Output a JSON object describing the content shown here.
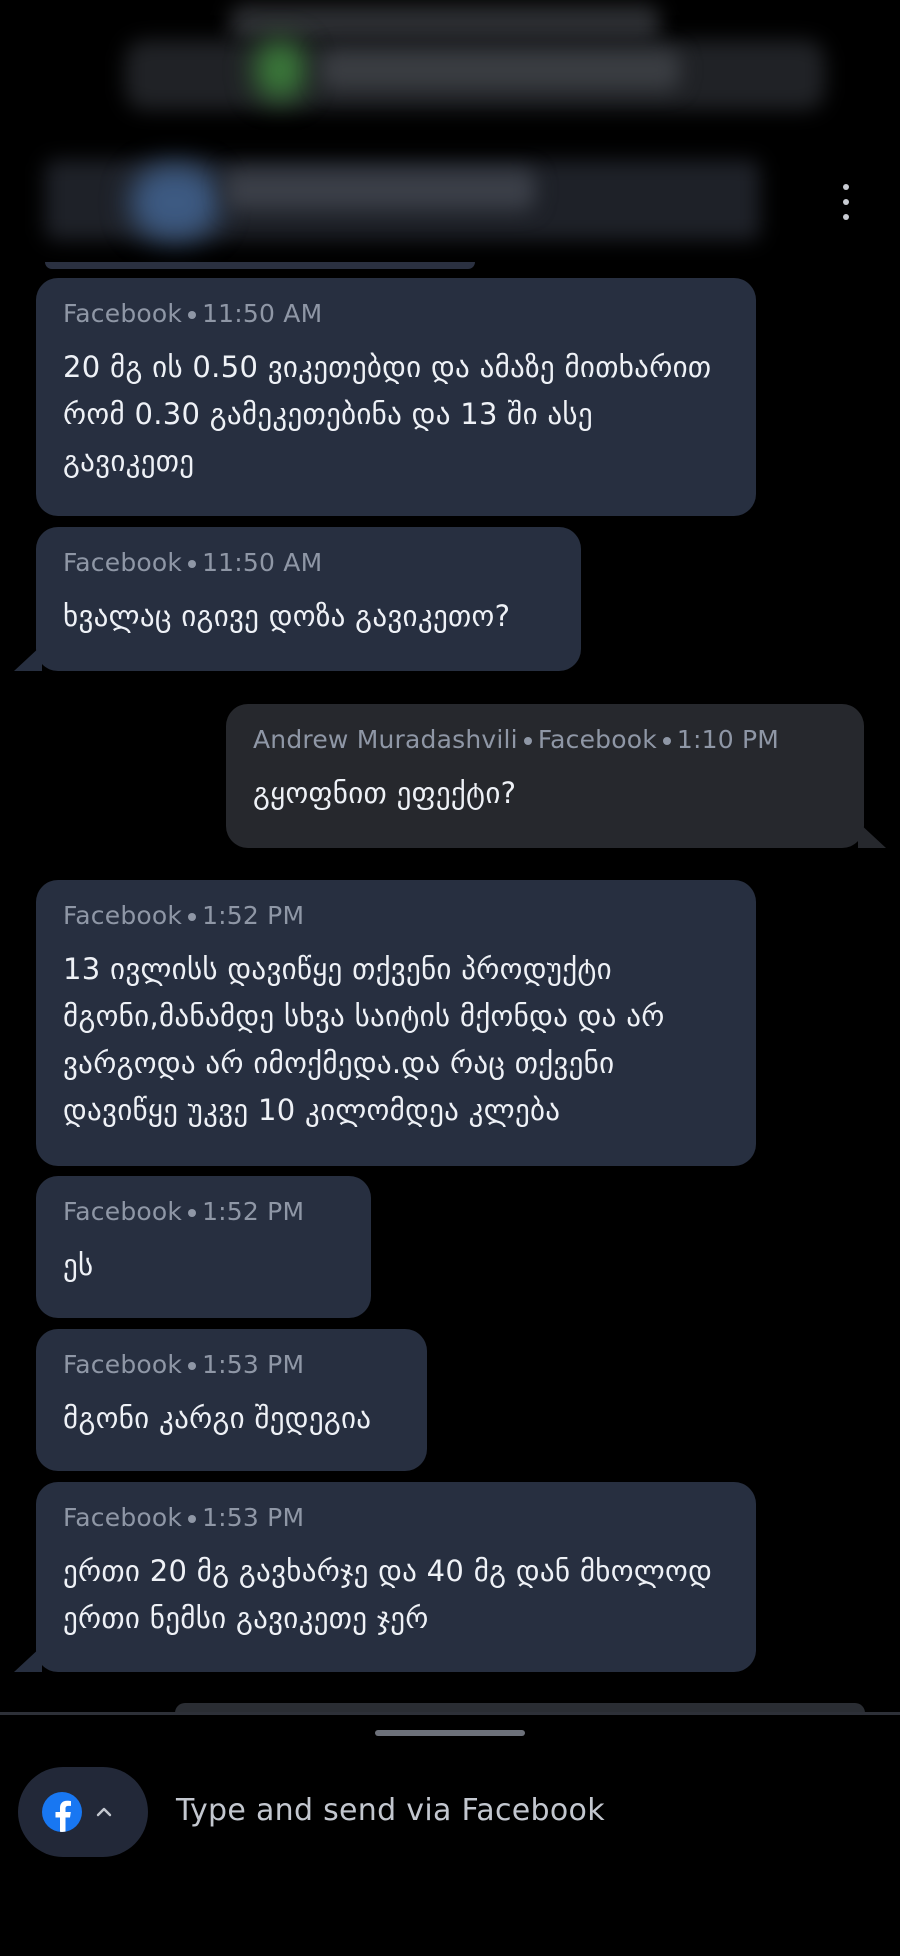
{
  "header": {
    "menu_icon": "more-vertical-icon"
  },
  "messages": [
    {
      "direction": "in",
      "sender": "",
      "channel": "Facebook",
      "time": "11:50 AM",
      "text": "20 მგ ის 0.50 ვიკეთებდი და ამაზე მითხარით რომ 0.30 გამეკეთებინა და 13 ში ასე გავიკეთე"
    },
    {
      "direction": "in",
      "sender": "",
      "channel": "Facebook",
      "time": "11:50 AM",
      "text": "ხვალაც იგივე დოზა გავიკეთო?"
    },
    {
      "direction": "out",
      "sender": "Andrew Muradashvili",
      "channel": "Facebook",
      "time": "1:10 PM",
      "text": "გყოფნით ეფექტი?"
    },
    {
      "direction": "in",
      "sender": "",
      "channel": "Facebook",
      "time": "1:52 PM",
      "text": "13 ივლისს დავიწყე თქვენი პროდუქტი მგონი,მანამდე სხვა საიტის მქონდა და არ ვარგოდა არ იმოქმედა.და რაც თქვენი დავიწყე უკვე 10 კილომდეა კლება"
    },
    {
      "direction": "in",
      "sender": "",
      "channel": "Facebook",
      "time": "1:52 PM",
      "text": "ეს"
    },
    {
      "direction": "in",
      "sender": "",
      "channel": "Facebook",
      "time": "1:53 PM",
      "text": "მგონი კარგი შედეგია"
    },
    {
      "direction": "in",
      "sender": "",
      "channel": "Facebook",
      "time": "1:53 PM",
      "text": "ერთი 20 მგ გავხარჯე და 40 მგ დან მხოლოდ ერთი ნემსი გავიკეთე ჯერ"
    }
  ],
  "composer": {
    "channel_icon": "facebook-icon",
    "placeholder": "Type and send via Facebook"
  },
  "colors": {
    "incoming_bubble": "#272f40",
    "outgoing_bubble": "#26282d",
    "facebook_blue": "#1877f2"
  }
}
